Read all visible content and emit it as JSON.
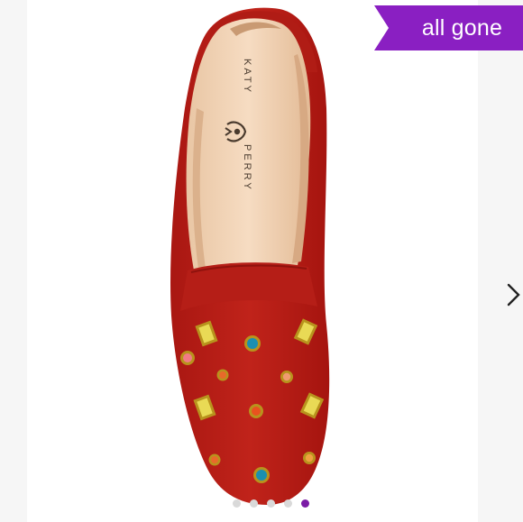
{
  "listing": {
    "status_badge": "all gone",
    "badge_color": "#8a1fc2",
    "active_dot_color": "#7b1ca6",
    "photo_count": 5,
    "active_photo": 5
  },
  "product_image": {
    "insole_brand_top": "KATY",
    "insole_brand_bottom": "PERRY"
  },
  "icons": {
    "next": "chevron-right-icon",
    "logo": "kp-eye-logo-icon"
  }
}
